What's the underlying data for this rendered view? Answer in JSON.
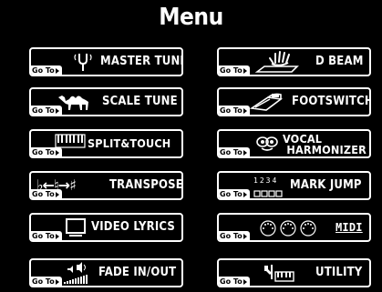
{
  "title": "Menu",
  "goto_label": "Go To",
  "buttons": [
    {
      "label": "MASTER TUNE",
      "icon": "tuning-fork-icon"
    },
    {
      "label": "D BEAM",
      "icon": "hand-beam-icon"
    },
    {
      "label": "SCALE TUNE",
      "icon": "camel-icon"
    },
    {
      "label": "FOOTSWITCH",
      "icon": "footswitch-icon"
    },
    {
      "label": "SPLIT&TOUCH",
      "icon": "keyboard-icon"
    },
    {
      "line1": "VOCAL",
      "line2": "HARMONIZER",
      "icon": "mask-icon"
    },
    {
      "label": "TRANSPOSE",
      "icon": "flat-natural-sharp-icon",
      "glyphs": "♭←♮→♯"
    },
    {
      "label": "MARK JUMP",
      "icon": "mark-numbers-icon",
      "digits": "1234"
    },
    {
      "label": "VIDEO LYRICS",
      "icon": "monitor-icon"
    },
    {
      "label": "MIDI",
      "icon": "midi-ports-icon"
    },
    {
      "label": "FADE IN/OUT",
      "icon": "fade-speaker-icon"
    },
    {
      "label": "UTILITY",
      "icon": "utility-tools-icon"
    }
  ]
}
